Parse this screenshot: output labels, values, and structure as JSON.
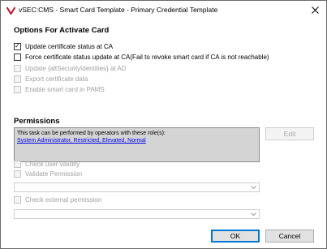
{
  "window": {
    "title": "vSEC:CMS - Smart Card Template - Primary Credential Template"
  },
  "options": {
    "heading": "Options For Activate Card",
    "items": [
      {
        "label": "Update certificate status at CA",
        "checked": true,
        "enabled": true
      },
      {
        "label": "Force certificate status update at CA(Fail to revoke smart card if CA is not reachable)",
        "checked": false,
        "enabled": true
      },
      {
        "label": "Update {altSecurityIdentities} at AD",
        "checked": false,
        "enabled": false
      },
      {
        "label": "Export certificate data",
        "checked": false,
        "enabled": false
      },
      {
        "label": "Enable smart card in PAMS",
        "checked": false,
        "enabled": false
      }
    ]
  },
  "permissions": {
    "heading": "Permissions",
    "description": "This task can be performed by operators with these role(s):",
    "roles": "System Administrator, Restricted, Elevated, Normal",
    "edit_label": "Edit",
    "check_user_validity": "Check user validity",
    "validate_permission": "Validate Permission",
    "validate_combo_value": "",
    "check_external_permission": "Check external permission",
    "external_combo_value": ""
  },
  "footer": {
    "ok_label": "OK",
    "cancel_label": "Cancel"
  },
  "colors": {
    "link": "#0000ee",
    "disabled_text": "#a0a0a0",
    "permission_box": "#d4d4d4",
    "default_button_border": "#0078d7"
  },
  "icons": {
    "app": "vsec-logo-icon",
    "close": "close-icon",
    "dropdown": "chevron-down-icon"
  }
}
